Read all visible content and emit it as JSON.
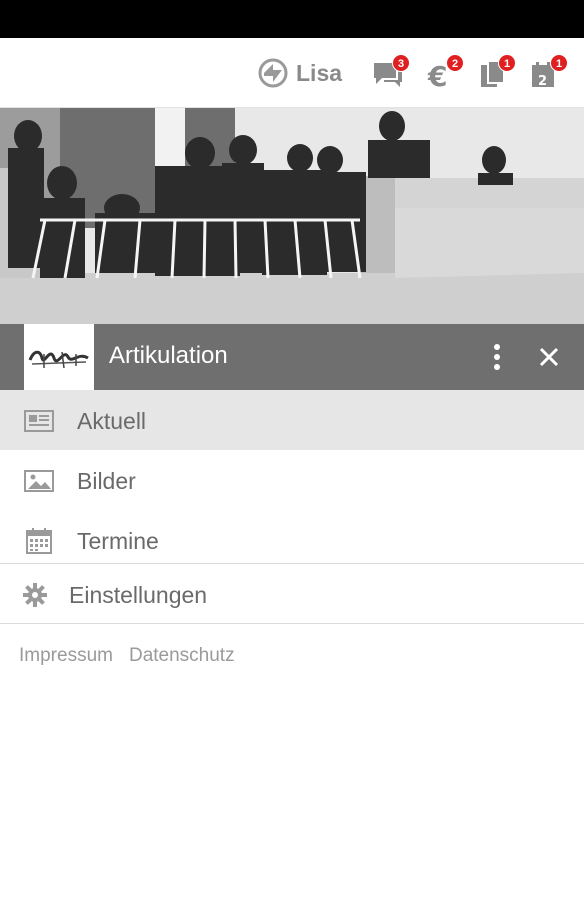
{
  "topbar": {
    "user_name": "Lisa",
    "icons": [
      {
        "name": "chat-icon",
        "badge": "3"
      },
      {
        "name": "euro-icon",
        "badge": "2"
      },
      {
        "name": "documents-icon",
        "badge": "1"
      },
      {
        "name": "calendar-icon",
        "badge": "1"
      }
    ]
  },
  "group": {
    "title": "Artikulation",
    "logo_icon": "artikulation-logo"
  },
  "nav": {
    "items": [
      {
        "label": "Aktuell",
        "icon": "newspaper-icon",
        "active": true
      },
      {
        "label": "Bilder",
        "icon": "image-icon",
        "active": false
      },
      {
        "label": "Termine",
        "icon": "calendar-grid-icon",
        "active": false
      }
    ],
    "settings_label": "Einstellungen"
  },
  "footer": {
    "impressum": "Impressum",
    "datenschutz": "Datenschutz"
  },
  "colors": {
    "badge": "#e02020",
    "group_bar": "#6f6f6f",
    "active_item": "#e6e6e6"
  }
}
